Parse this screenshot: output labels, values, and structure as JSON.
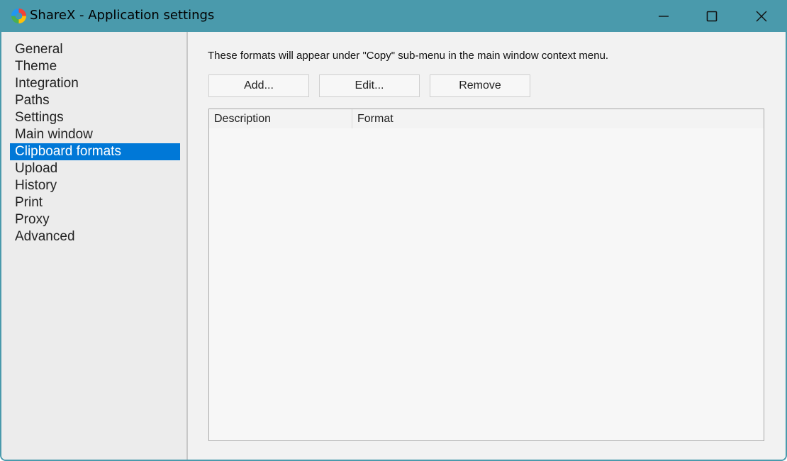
{
  "window": {
    "title": "ShareX - Application settings",
    "app_icon": "sharex-logo-icon",
    "controls": {
      "minimize": "minimize-icon",
      "maximize": "maximize-icon",
      "close": "close-icon"
    },
    "titlebar_color": "#4a9aac"
  },
  "sidebar": {
    "items": [
      {
        "label": "General"
      },
      {
        "label": "Theme"
      },
      {
        "label": "Integration"
      },
      {
        "label": "Paths"
      },
      {
        "label": "Settings"
      },
      {
        "label": "Main window"
      },
      {
        "label": "Clipboard formats",
        "selected": true
      },
      {
        "label": "Upload"
      },
      {
        "label": "History"
      },
      {
        "label": "Print"
      },
      {
        "label": "Proxy"
      },
      {
        "label": "Advanced"
      }
    ],
    "selected_color": "#0078d7"
  },
  "content": {
    "description": "These formats will appear under \"Copy\" sub-menu in the main window context menu.",
    "buttons": {
      "add": "Add...",
      "edit": "Edit...",
      "remove": "Remove"
    },
    "list": {
      "columns": [
        "Description",
        "Format"
      ],
      "rows": []
    }
  }
}
